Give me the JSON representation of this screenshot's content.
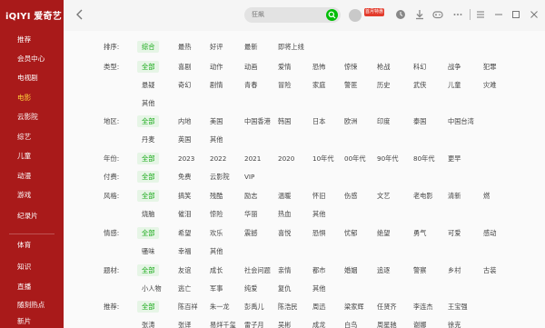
{
  "app": {
    "logo": "iQIYI 爱奇艺"
  },
  "sidebar": {
    "items": [
      {
        "label": "推荐",
        "active": false
      },
      {
        "label": "会员中心",
        "active": false
      },
      {
        "label": "电视剧",
        "active": false
      },
      {
        "label": "电影",
        "active": true
      },
      {
        "label": "云影院",
        "active": false
      },
      {
        "label": "综艺",
        "active": false
      },
      {
        "label": "儿童",
        "active": false
      },
      {
        "label": "动漫",
        "active": false
      },
      {
        "label": "游戏",
        "active": false
      },
      {
        "label": "纪录片",
        "active": false
      },
      {
        "label": "体育",
        "active": false
      },
      {
        "label": "知识",
        "active": false
      },
      {
        "label": "直播",
        "active": false
      },
      {
        "label": "随刻热点",
        "active": false
      },
      {
        "label": "新片",
        "active": false
      }
    ]
  },
  "topbar": {
    "search_text": "狂飙",
    "vip_badge": "首月特惠",
    "icons": [
      "history-icon",
      "download-icon",
      "game-icon",
      "menu-icon",
      "minimize-icon",
      "maximize-icon",
      "close-icon"
    ]
  },
  "filters": [
    {
      "label": "排序:",
      "rows": [
        [
          "综合",
          "最热",
          "好评",
          "最新",
          "即将上线"
        ]
      ],
      "selected": "综合"
    },
    {
      "label": "类型:",
      "rows": [
        [
          "全部",
          "喜剧",
          "动作",
          "动画",
          "爱情",
          "恐怖",
          "惊悚",
          "枪战",
          "科幻",
          "战争",
          "犯罪"
        ],
        [
          "悬疑",
          "奇幻",
          "剧情",
          "青春",
          "冒险",
          "家庭",
          "警匪",
          "历史",
          "武侠",
          "儿童",
          "灾难"
        ],
        [
          "其他"
        ]
      ],
      "selected": "全部"
    },
    {
      "label": "地区:",
      "rows": [
        [
          "全部",
          "内地",
          "美国",
          "中国香港",
          "韩国",
          "日本",
          "欧洲",
          "印度",
          "泰国",
          "中国台湾"
        ],
        [
          "丹麦",
          "英国",
          "其他"
        ]
      ],
      "selected": "全部"
    },
    {
      "label": "年份:",
      "rows": [
        [
          "全部",
          "2023",
          "2022",
          "2021",
          "2020",
          "10年代",
          "00年代",
          "90年代",
          "80年代",
          "更早"
        ]
      ],
      "selected": "全部"
    },
    {
      "label": "付费:",
      "rows": [
        [
          "全部",
          "免费",
          "云影院",
          "VIP"
        ]
      ],
      "selected": "全部"
    },
    {
      "label": "风格:",
      "rows": [
        [
          "全部",
          "搞笑",
          "残酷",
          "励志",
          "温暖",
          "怀旧",
          "伤感",
          "文艺",
          "老电影",
          "清新",
          "燃"
        ],
        [
          "烧脑",
          "催泪",
          "惊险",
          "华丽",
          "热血",
          "其他"
        ]
      ],
      "selected": "全部"
    },
    {
      "label": "情感:",
      "rows": [
        [
          "全部",
          "希望",
          "欢乐",
          "震撼",
          "喜悦",
          "恐惧",
          "忧郁",
          "绝望",
          "勇气",
          "可爱",
          "感动"
        ],
        [
          "骚味",
          "幸福",
          "其他"
        ]
      ],
      "selected": "全部"
    },
    {
      "label": "题材:",
      "rows": [
        [
          "全部",
          "友谊",
          "成长",
          "社会问题",
          "亲情",
          "都市",
          "婚姻",
          "追逐",
          "警察",
          "乡村",
          "古装"
        ],
        [
          "小人物",
          "逃亡",
          "军事",
          "纯爱",
          "复仇",
          "其他"
        ]
      ],
      "selected": "全部"
    },
    {
      "label": "推荐:",
      "rows": [
        [
          "全部",
          "陈百祥",
          "朱一龙",
          "彭禹儿",
          "陈浩民",
          "周迅",
          "梁家辉",
          "任贤齐",
          "李连杰",
          "王宝强"
        ],
        [
          "张涛",
          "张译",
          "易烊千玺",
          "雷子月",
          "吴彬",
          "成龙",
          "白鸟",
          "周星驰",
          "谢娜",
          "徐克"
        ]
      ],
      "selected": "全部"
    }
  ]
}
